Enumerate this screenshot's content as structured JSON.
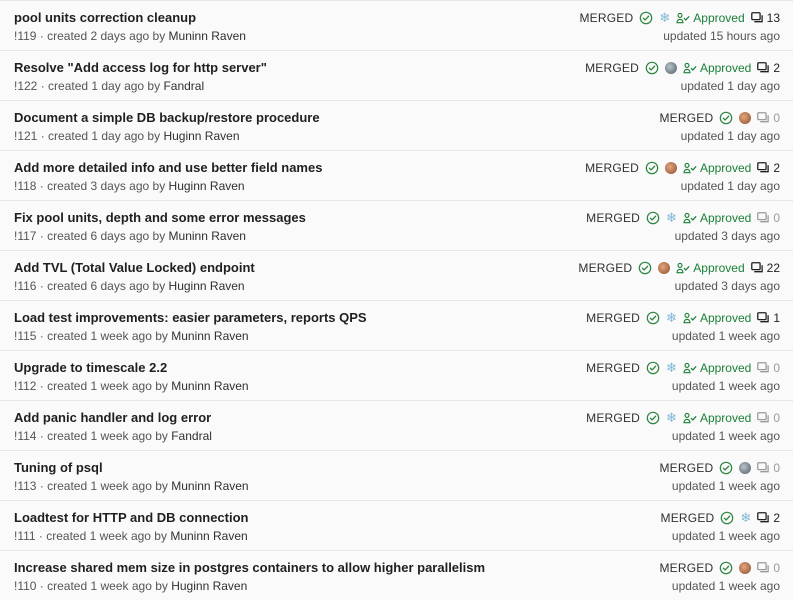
{
  "merge_requests": [
    {
      "title": "pool units correction cleanup",
      "meta": "!119 · created 2 days ago by ",
      "author": "Muninn Raven",
      "status": "MERGED",
      "avatar": "snowflake",
      "approved": "Approved",
      "comments": "13",
      "updated": "updated 15 hours ago"
    },
    {
      "title": "Resolve \"Add access log for http server\"",
      "meta": "!122 · created 1 day ago by ",
      "author": "Fandral",
      "status": "MERGED",
      "avatar": "gray",
      "approved": "Approved",
      "comments": "2",
      "updated": "updated 1 day ago"
    },
    {
      "title": "Document a simple DB backup/restore procedure",
      "meta": "!121 · created 1 day ago by ",
      "author": "Huginn Raven",
      "status": "MERGED",
      "avatar": "brown",
      "approved": "",
      "comments": "0",
      "updated": "updated 1 day ago"
    },
    {
      "title": "Add more detailed info and use better field names",
      "meta": "!118 · created 3 days ago by ",
      "author": "Huginn Raven",
      "status": "MERGED",
      "avatar": "brown",
      "approved": "Approved",
      "comments": "2",
      "updated": "updated 1 day ago"
    },
    {
      "title": "Fix pool units, depth and some error messages",
      "meta": "!117 · created 6 days ago by ",
      "author": "Muninn Raven",
      "status": "MERGED",
      "avatar": "snowflake",
      "approved": "Approved",
      "comments": "0",
      "updated": "updated 3 days ago"
    },
    {
      "title": "Add TVL (Total Value Locked) endpoint",
      "meta": "!116 · created 6 days ago by ",
      "author": "Huginn Raven",
      "status": "MERGED",
      "avatar": "brown",
      "approved": "Approved",
      "comments": "22",
      "updated": "updated 3 days ago"
    },
    {
      "title": "Load test improvements: easier parameters, reports QPS",
      "meta": "!115 · created 1 week ago by ",
      "author": "Muninn Raven",
      "status": "MERGED",
      "avatar": "snowflake",
      "approved": "Approved",
      "comments": "1",
      "updated": "updated 1 week ago"
    },
    {
      "title": "Upgrade to timescale 2.2",
      "meta": "!112 · created 1 week ago by ",
      "author": "Muninn Raven",
      "status": "MERGED",
      "avatar": "snowflake",
      "approved": "Approved",
      "comments": "0",
      "updated": "updated 1 week ago"
    },
    {
      "title": "Add panic handler and log error",
      "meta": "!114 · created 1 week ago by ",
      "author": "Fandral",
      "status": "MERGED",
      "avatar": "snowflake",
      "approved": "Approved",
      "comments": "0",
      "updated": "updated 1 week ago"
    },
    {
      "title": "Tuning of psql",
      "meta": "!113 · created 1 week ago by ",
      "author": "Muninn Raven",
      "status": "MERGED",
      "avatar": "gray",
      "approved": "",
      "comments": "0",
      "updated": "updated 1 week ago"
    },
    {
      "title": "Loadtest for HTTP and DB connection",
      "meta": "!111 · created 1 week ago by ",
      "author": "Muninn Raven",
      "status": "MERGED",
      "avatar": "snowflake",
      "approved": "",
      "comments": "2",
      "updated": "updated 1 week ago"
    },
    {
      "title": "Increase shared mem size in postgres containers to allow higher parallelism",
      "meta": "!110 · created 1 week ago by ",
      "author": "Huginn Raven",
      "status": "MERGED",
      "avatar": "brown",
      "approved": "",
      "comments": "0",
      "updated": "updated 1 week ago"
    }
  ],
  "colors": {
    "approved": "#1a7f37",
    "check": "#2e8540",
    "row_bg": "#fafafa",
    "divider": "#e6e6e6"
  }
}
